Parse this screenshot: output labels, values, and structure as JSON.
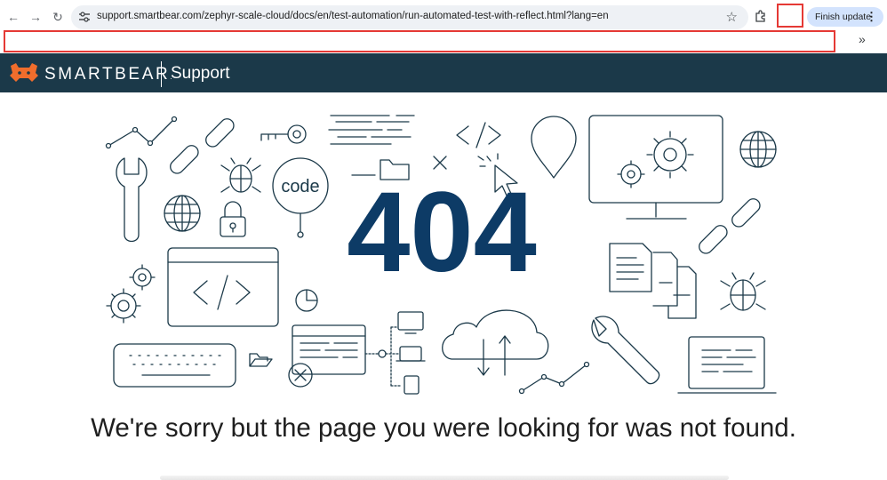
{
  "browser": {
    "url": "support.smartbear.com/zephyr-scale-cloud/docs/en/test-automation/run-automated-test-with-reflect.html?lang=en",
    "finish_update_label": "Finish update",
    "bookmarks_overflow": "»"
  },
  "header": {
    "brand": "SMARTBEAR",
    "brand_mark": ".",
    "section": "Support"
  },
  "error": {
    "code": "404",
    "code_word": "code",
    "message": "We're sorry but the page you were looking for was not found."
  },
  "colors": {
    "header_bg": "#1b3949",
    "logo_orange": "#f06d2c",
    "code_navy": "#0d3b66",
    "line_art": "#1b3949"
  }
}
